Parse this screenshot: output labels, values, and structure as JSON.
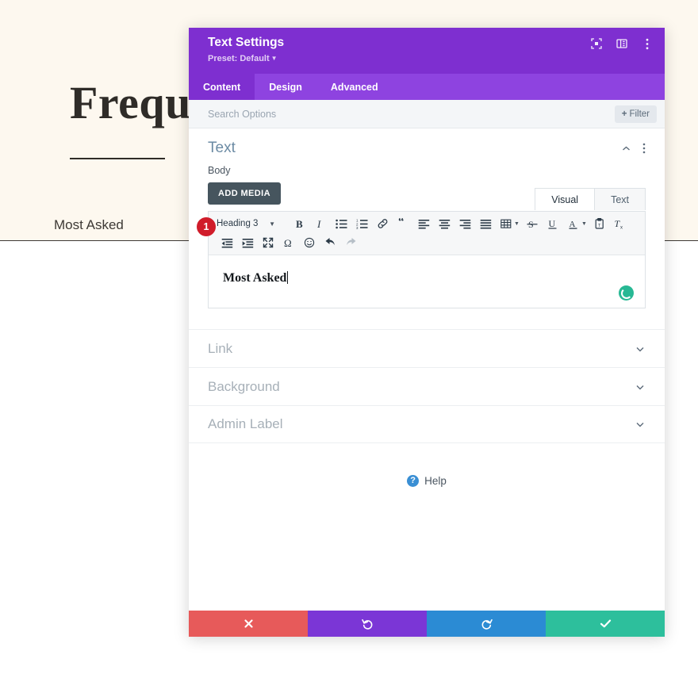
{
  "background_page": {
    "heading": "Frequen",
    "subheading": "Most Asked",
    "bg_color": "#fdf8ef"
  },
  "modal": {
    "title": "Text Settings",
    "preset_label": "Preset: Default",
    "accent_color": "#7e2fd0",
    "header_icons": [
      {
        "name": "focus-icon"
      },
      {
        "name": "layout-panel-icon"
      },
      {
        "name": "more-vertical-icon"
      }
    ],
    "tabs": [
      {
        "label": "Content",
        "active": true
      },
      {
        "label": "Design",
        "active": false
      },
      {
        "label": "Advanced",
        "active": false
      }
    ],
    "search": {
      "placeholder": "Search Options",
      "value": "",
      "filter_label": "Filter",
      "filter_plus": "+"
    },
    "section": {
      "title": "Text",
      "collapse_icon": "chevron-up-icon",
      "menu_icon": "more-vertical-icon"
    },
    "field": {
      "label": "Body",
      "add_media_label": "ADD MEDIA"
    },
    "editor": {
      "tabs": [
        {
          "label": "Visual",
          "active": true
        },
        {
          "label": "Text",
          "active": false
        }
      ],
      "format_select": "Heading 3",
      "content_text": "Most Asked",
      "toolbar_row1": [
        "bold-icon",
        "italic-icon",
        "bulleted-list-icon",
        "numbered-list-icon",
        "link-icon",
        "blockquote-icon",
        "align-left-icon",
        "align-center-icon",
        "align-right-icon",
        "align-justify-icon",
        "table-icon",
        "strikethrough-icon",
        "underline-icon",
        "text-color-icon",
        "paste-as-text-icon",
        "clear-formatting-icon"
      ],
      "toolbar_row2": [
        "outdent-icon",
        "indent-icon",
        "fullscreen-icon",
        "special-character-icon",
        "emoji-icon",
        "undo-icon",
        "redo-icon"
      ],
      "status_icon": "saving-spinner",
      "status_color": "#27b894"
    },
    "step_marker": "1",
    "accordion": [
      {
        "label": "Link"
      },
      {
        "label": "Background"
      },
      {
        "label": "Admin Label"
      }
    ],
    "help": {
      "label": "Help",
      "icon": "question-circle-icon"
    },
    "footer": [
      {
        "name": "cancel-button",
        "icon": "close-icon",
        "color": "#e75a5a"
      },
      {
        "name": "undo-button",
        "icon": "undo-icon",
        "color": "#7b36d6"
      },
      {
        "name": "redo-button",
        "icon": "redo-icon",
        "color": "#2b8bd4"
      },
      {
        "name": "save-button",
        "icon": "check-icon",
        "color": "#2dbf9c"
      }
    ]
  }
}
